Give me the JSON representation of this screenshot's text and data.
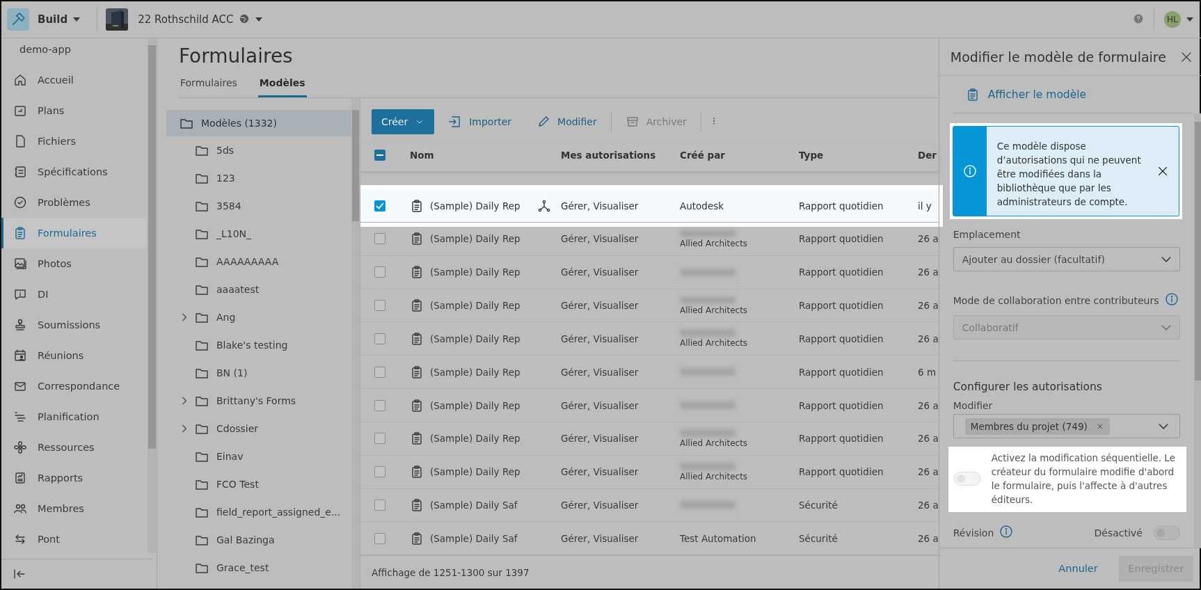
{
  "topbar": {
    "product": "Build",
    "project": "22 Rothschild ACC",
    "user_initials": "HL"
  },
  "nav": {
    "account": "demo-app",
    "items": [
      {
        "label": "Accueil",
        "selected": false
      },
      {
        "label": "Plans",
        "selected": false
      },
      {
        "label": "Fichiers",
        "selected": false
      },
      {
        "label": "Spécifications",
        "selected": false
      },
      {
        "label": "Problèmes",
        "selected": false
      },
      {
        "label": "Formulaires",
        "selected": true
      },
      {
        "label": "Photos",
        "selected": false
      },
      {
        "label": "DI",
        "selected": false
      },
      {
        "label": "Soumissions",
        "selected": false
      },
      {
        "label": "Réunions",
        "selected": false
      },
      {
        "label": "Correspondance",
        "selected": false
      },
      {
        "label": "Planification",
        "selected": false
      },
      {
        "label": "Ressources",
        "selected": false
      },
      {
        "label": "Rapports",
        "selected": false
      },
      {
        "label": "Membres",
        "selected": false
      },
      {
        "label": "Pont",
        "selected": false
      }
    ]
  },
  "page": {
    "title": "Formulaires",
    "tabs": [
      {
        "label": "Formulaires",
        "selected": false
      },
      {
        "label": "Modèles",
        "selected": true
      }
    ]
  },
  "folders": [
    {
      "label": "Modèles (1332)",
      "selected": true,
      "children": [
        {
          "label": "5ds",
          "expandable": false
        },
        {
          "label": "123",
          "expandable": false
        },
        {
          "label": "3584",
          "expandable": false
        },
        {
          "label": "_L10N_",
          "expandable": false
        },
        {
          "label": "AAAAAAAAA",
          "expandable": false
        },
        {
          "label": "aaaatest",
          "expandable": false
        },
        {
          "label": "Ang",
          "expandable": true
        },
        {
          "label": "Blake's testing",
          "expandable": false
        },
        {
          "label": "BN (1)",
          "expandable": false
        },
        {
          "label": "Brittany's Forms",
          "expandable": true
        },
        {
          "label": "Cdossier",
          "expandable": true
        },
        {
          "label": "Einav",
          "expandable": false
        },
        {
          "label": "FCO Test",
          "expandable": false
        },
        {
          "label": "field_report_assigned_e...",
          "expandable": false
        },
        {
          "label": "Gal Bazinga",
          "expandable": false
        },
        {
          "label": "Grace_test",
          "expandable": false
        }
      ]
    }
  ],
  "toolbar": [
    {
      "label": "Créer",
      "kind": "primary"
    },
    {
      "label": "Importer",
      "kind": "normal"
    },
    {
      "label": "Modifier",
      "kind": "normal"
    },
    {
      "label": "Archiver",
      "kind": "disabled"
    }
  ],
  "table": {
    "select_all_partial": true,
    "columns": [
      "Nom",
      "Mes autorisations",
      "Créé par",
      "Type",
      "Der"
    ],
    "rows": [
      {
        "selected": true,
        "checked": true,
        "name": "(Sample) Daily Rep",
        "shared": true,
        "permissions": "Gérer, Visualiser",
        "created_by": "Autodesk",
        "redacted": false,
        "type": "Rapport quotidien",
        "column_5": "il y"
      },
      {
        "selected": false,
        "checked": false,
        "name": "(Sample) Daily Rep",
        "shared": false,
        "permissions": "Gérer, Visualiser",
        "redacted": true,
        "company": "Allied Architects",
        "type": "Rapport quotidien",
        "column_5": "26 a"
      },
      {
        "selected": false,
        "checked": false,
        "name": "(Sample) Daily Rep",
        "shared": false,
        "permissions": "Gérer, Visualiser",
        "redacted": true,
        "type": "Rapport quotidien",
        "column_5": "26 a"
      },
      {
        "selected": false,
        "checked": false,
        "name": "(Sample) Daily Rep",
        "shared": false,
        "permissions": "Gérer, Visualiser",
        "redacted": true,
        "company": "Allied Architects",
        "type": "Rapport quotidien",
        "column_5": "26 a"
      },
      {
        "selected": false,
        "checked": false,
        "name": "(Sample) Daily Rep",
        "shared": false,
        "permissions": "Gérer, Visualiser",
        "redacted": true,
        "company": "Allied Architects",
        "type": "Rapport quotidien",
        "column_5": "26 a"
      },
      {
        "selected": false,
        "checked": false,
        "name": "(Sample) Daily Rep",
        "shared": false,
        "permissions": "Gérer, Visualiser",
        "redacted": true,
        "type": "Rapport quotidien",
        "column_5": "6 m"
      },
      {
        "selected": false,
        "checked": false,
        "name": "(Sample) Daily Rep",
        "shared": false,
        "permissions": "Gérer, Visualiser",
        "redacted": true,
        "type": "Rapport quotidien",
        "column_5": "26 a"
      },
      {
        "selected": false,
        "checked": false,
        "name": "(Sample) Daily Rep",
        "shared": false,
        "permissions": "Gérer, Visualiser",
        "redacted": true,
        "company": "Allied Architects",
        "type": "Rapport quotidien",
        "column_5": "26 a"
      },
      {
        "selected": false,
        "checked": false,
        "name": "(Sample) Daily Rep",
        "shared": false,
        "permissions": "Gérer, Visualiser",
        "redacted": true,
        "company": "Allied Architects",
        "type": "Rapport quotidien",
        "column_5": "26 a"
      },
      {
        "selected": false,
        "checked": false,
        "name": "(Sample) Daily Saf",
        "shared": false,
        "permissions": "Gérer, Visualiser",
        "redacted": true,
        "type": "Sécurité",
        "column_5": "26 a"
      },
      {
        "selected": false,
        "checked": false,
        "name": "(Sample) Daily Saf",
        "shared": false,
        "permissions": "Gérer, Visualiser",
        "created_by": "Test Automation",
        "redacted": false,
        "type": "Sécurité",
        "column_5": "26 a"
      }
    ],
    "footer": "Affichage de 1251-1300 sur 1397"
  },
  "panel": {
    "title": "Modifier le modèle de formulaire",
    "view_link": "Afficher le modèle",
    "banner": "Ce modèle dispose d’autorisations qui ne peuvent être modifiées dans la bibliothèque que par les administrateurs de compte.",
    "location": {
      "label": "Emplacement",
      "placeholder": "Ajouter au dossier (facultatif)"
    },
    "collab": {
      "label": "Mode de collaboration entre contributeurs",
      "value": "Collaboratif",
      "disabled": true
    },
    "permissions": {
      "heading": "Configurer les autorisations",
      "label": "Modifier",
      "chips": [
        "Membres du projet (749)"
      ]
    },
    "sequential": {
      "on": false,
      "text": "Activez la modification séquentielle. Le créateur du formulaire modifie d'abord le formulaire, puis l'affecte à d'autres éditeurs."
    },
    "revision": {
      "label": "Révision",
      "status": "Désactivé",
      "on": false
    },
    "cancel": "Annuler",
    "save": "Enregistrer",
    "save_disabled": true
  }
}
